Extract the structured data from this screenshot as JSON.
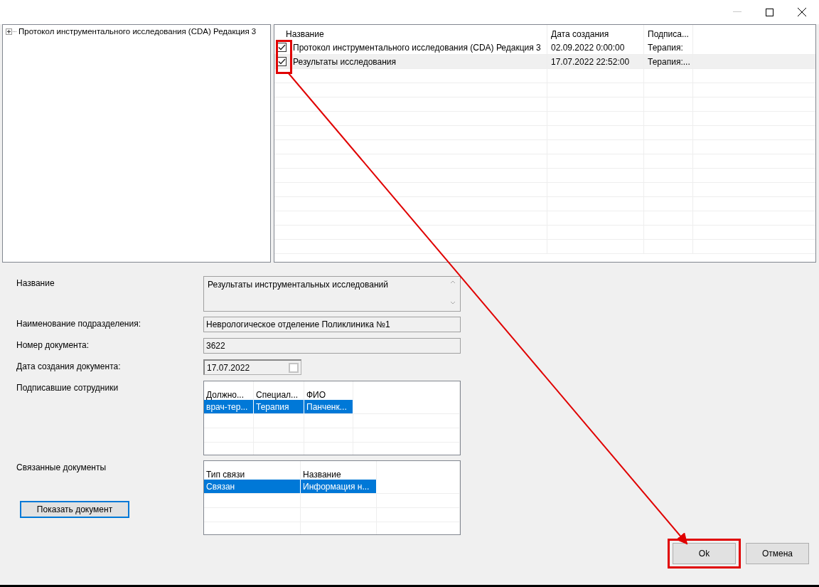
{
  "tree": {
    "items": [
      {
        "label": "Протокол инструментального исследования (CDA) Редакция 3",
        "expanded": false
      }
    ]
  },
  "documents": {
    "columns": [
      "Название",
      "Дата создания",
      "Подписа..."
    ],
    "rows": [
      {
        "checked": true,
        "selected": false,
        "cells": [
          "Протокол инструментального исследования (CDA) Редакция 3",
          "02.09.2022 0:00:00",
          "Терапия:"
        ]
      },
      {
        "checked": true,
        "selected": true,
        "cells": [
          "Результаты исследования",
          "17.07.2022 22:52:00",
          "Терапия:..."
        ]
      }
    ]
  },
  "form": {
    "name_label": "Название",
    "name_value": "Результаты инструментальных исследований",
    "department_label": "Наименование подразделения:",
    "department_value": "Неврологическое отделение Поликлиника №1",
    "number_label": "Номер документа:",
    "number_value": "3622",
    "date_label": "Дата создания документа:",
    "date_value": "17.07.2022",
    "date_checked": false,
    "signers_label": "Подписавшие сотрудники",
    "signers": {
      "columns": [
        "Должно...",
        "Специал...",
        "ФИО"
      ],
      "rows": [
        {
          "selected": true,
          "cells": [
            "врач-тер...",
            "Терапия",
            "Панченк..."
          ]
        }
      ]
    },
    "linked_label": "Связанные документы",
    "linked": {
      "columns": [
        "Тип связи",
        "Название"
      ],
      "rows": [
        {
          "selected": true,
          "cells": [
            "Связан",
            "Информация н..."
          ]
        }
      ]
    },
    "show_button": "Показать документ"
  },
  "buttons": [
    {
      "label": "Ok",
      "highlighted": true
    },
    {
      "label": "Отмена",
      "highlighted": false
    }
  ]
}
